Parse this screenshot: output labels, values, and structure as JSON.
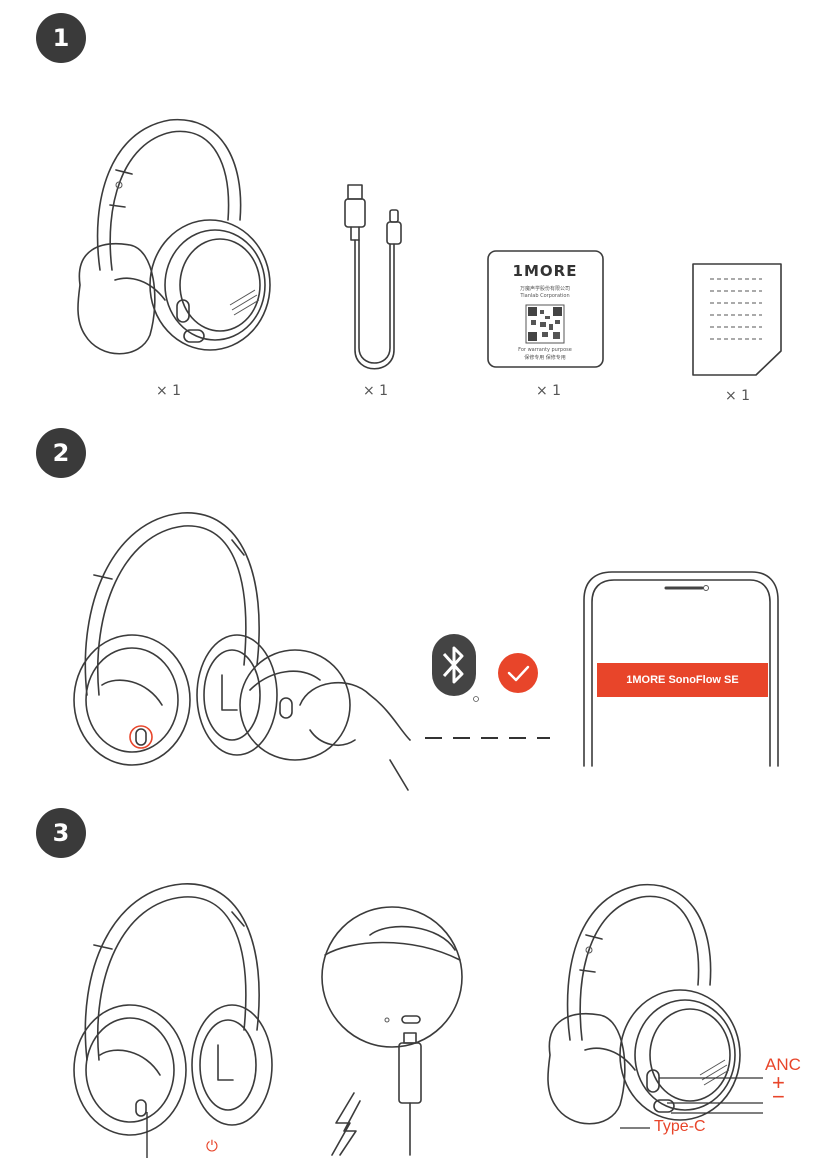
{
  "steps": [
    {
      "number": "1"
    },
    {
      "number": "2"
    },
    {
      "number": "3"
    }
  ],
  "box_contents": {
    "quantities": [
      "× 1",
      "× 1",
      "× 1",
      "× 1"
    ],
    "warranty_card": {
      "brand": "1MORE",
      "company_cn": "万魔声学股份有限公司",
      "company_en": "Tianlab Corporation",
      "footer_en": "For warranty purpose",
      "footer_cn": "保修专用 保修专用"
    }
  },
  "pairing": {
    "device_name": "1MORE SonoFlow SE"
  },
  "controls": {
    "power_label": "⏻",
    "anc_label": "ANC",
    "plus_label": "+",
    "minus_label": "−",
    "port_label": "Type-C"
  },
  "colors": {
    "accent": "#e8452a",
    "badge": "#3a3a3a",
    "line": "#3b3b3b"
  }
}
